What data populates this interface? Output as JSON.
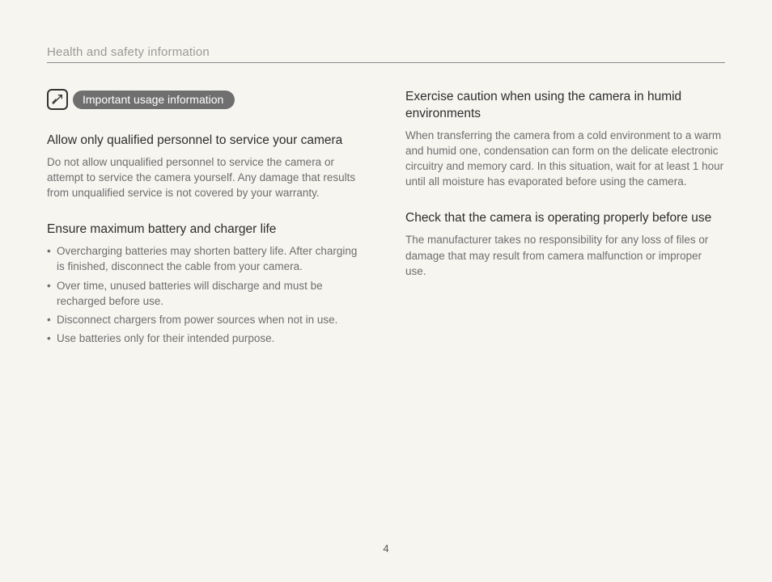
{
  "header": {
    "title": "Health and safety information"
  },
  "pill": {
    "label": "Important usage information"
  },
  "left": {
    "s1": {
      "heading": "Allow only qualified personnel to service your camera",
      "body": "Do not allow unqualified personnel to service the camera or attempt to service the camera yourself. Any damage that results from unqualified service is not covered by your warranty."
    },
    "s2": {
      "heading": "Ensure maximum battery and charger life",
      "bullets": [
        "Overcharging batteries may shorten battery life. After charging is finished, disconnect the cable from your camera.",
        "Over time, unused batteries will discharge and must be recharged before use.",
        "Disconnect chargers from power sources when not in use.",
        "Use batteries only for their intended purpose."
      ]
    }
  },
  "right": {
    "s1": {
      "heading": "Exercise caution when using the camera in humid environments",
      "body": "When transferring the camera from a cold environment to a warm and humid one, condensation can form on the delicate electronic circuitry and memory card. In this situation, wait for at least 1 hour until all moisture has evaporated before using the camera."
    },
    "s2": {
      "heading": "Check that the camera is operating properly before use",
      "body": "The manufacturer takes no responsibility for any loss of files or damage that may result from camera malfunction or improper use."
    }
  },
  "pageNumber": "4"
}
